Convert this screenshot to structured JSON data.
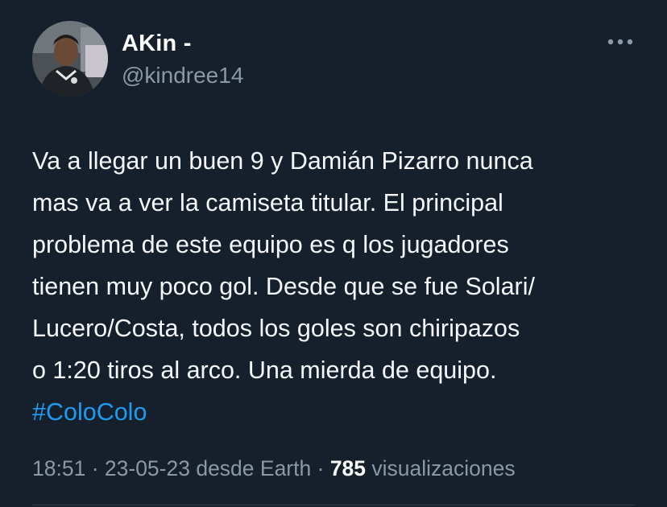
{
  "author": {
    "display_name": "AKin -",
    "handle": "@kindree14",
    "avatar_icon": "profile-photo"
  },
  "menu": {
    "more_icon": "more-horizontal-icon"
  },
  "tweet": {
    "lines": [
      "Va a llegar un buen 9 y Damián Pizarro nunca",
      "mas va a ver la camiseta titular. El principal",
      "problema de este equipo es q los jugadores",
      "tienen muy poco gol. Desde que se fue Solari/",
      "Lucero/Costa, todos los goles son chiripazos",
      "o 1:20 tiros al arco. Una mierda de equipo."
    ],
    "hashtag": "#ColoColo"
  },
  "meta": {
    "time": "18:51",
    "sep1": " · ",
    "date": "23-05-23",
    "source": " desde Earth",
    "sep2": " · ",
    "views_count": "785",
    "views_label": " visualizaciones"
  },
  "colors": {
    "background": "#16202c",
    "text": "#f5f7f8",
    "secondary": "#8b98a5",
    "link": "#1d9bf0"
  }
}
